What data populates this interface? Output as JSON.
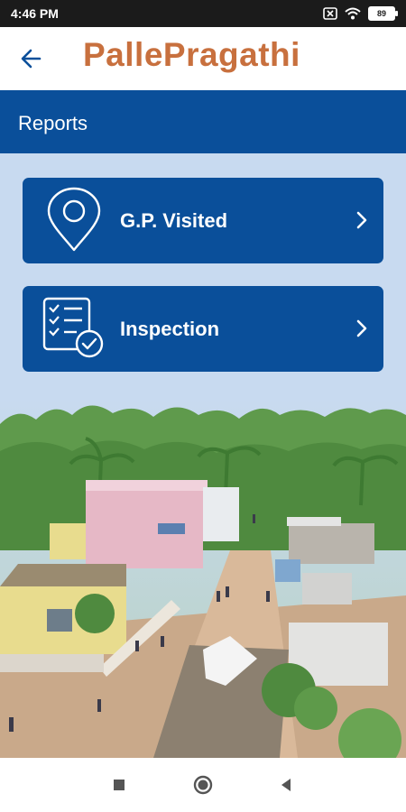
{
  "status_bar": {
    "time": "4:46 PM",
    "battery": "89",
    "icons": [
      "sim-x-icon",
      "wifi-icon",
      "battery-icon"
    ]
  },
  "app_bar": {
    "title": "PallePragathi",
    "back_icon": "back-arrow-icon",
    "title_color": "#c8703e"
  },
  "section": {
    "title": "Reports",
    "color": "#0a4f9a"
  },
  "menu": [
    {
      "label": "G.P. Visited",
      "icon": "location-pin-icon"
    },
    {
      "label": "Inspection",
      "icon": "checklist-icon"
    }
  ],
  "nav_bar": {
    "buttons": [
      "recents-button",
      "home-button",
      "back-button"
    ]
  }
}
